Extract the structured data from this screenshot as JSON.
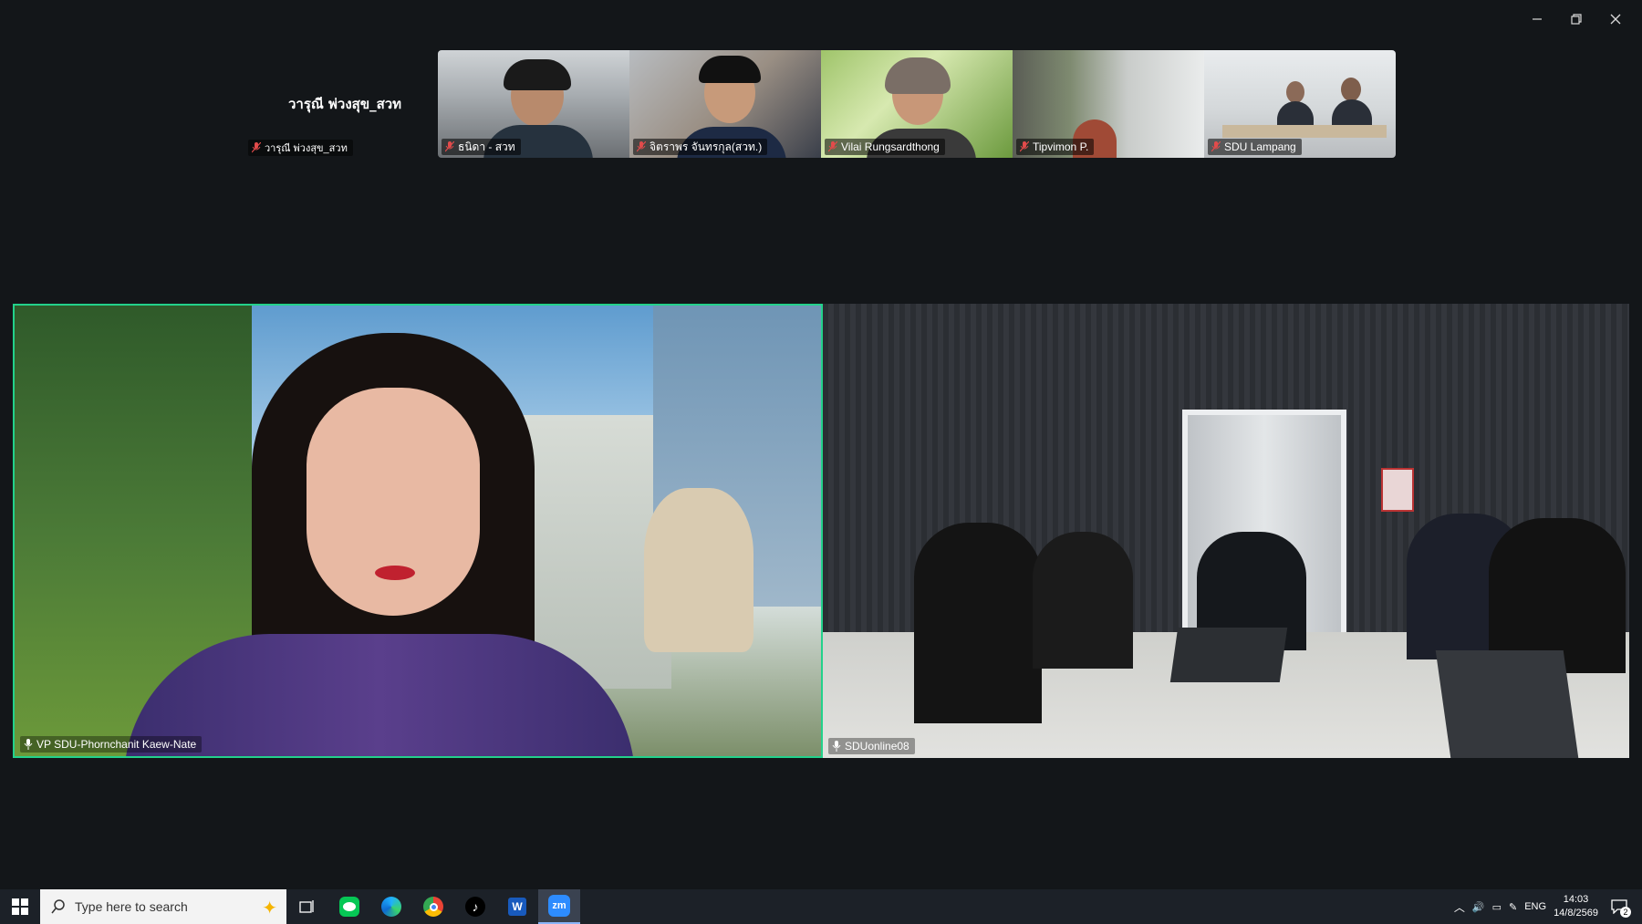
{
  "self": {
    "display_name": "วารุณี พ่วงสุข_สวท",
    "tag_label": "วารุณี พ่วงสุข_สวท"
  },
  "thumbnails": [
    {
      "label": "ธนิดา - สวท"
    },
    {
      "label": "จิตราพร จันทรกุล(สวท.)"
    },
    {
      "label": "Vilai Rungsardthong"
    },
    {
      "label": "Tipvimon P."
    },
    {
      "label": "SDU Lampang"
    }
  ],
  "main_videos": [
    {
      "label": "VP SDU-Phornchanit Kaew-Nate"
    },
    {
      "label": "SDUonline08"
    }
  ],
  "colors": {
    "active_speaker_border": "#23d18b",
    "background": "#131619",
    "mic_muted": "#e24b4b"
  },
  "taskbar": {
    "search_placeholder": "Type here to search",
    "apps": [
      "task-view-icon",
      "line-icon",
      "edge-icon",
      "chrome-icon",
      "tiktok-icon",
      "word-icon",
      "zoom-icon"
    ],
    "language": "ENG",
    "time": "14:03",
    "date": "14/8/2569",
    "notification_count": "2"
  }
}
